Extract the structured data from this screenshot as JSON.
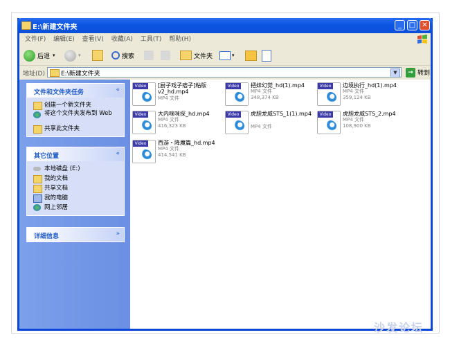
{
  "window": {
    "title": "E:\\新建文件夹"
  },
  "menu": [
    "文件(F)",
    "编辑(E)",
    "查看(V)",
    "收藏(A)",
    "工具(T)",
    "帮助(H)"
  ],
  "toolbar": {
    "back": "后退",
    "search": "搜索",
    "folders": "文件夹"
  },
  "address": {
    "label": "地址(D)",
    "path": "E:\\新建文件夹",
    "go": "转到"
  },
  "sidebar": {
    "tasks": {
      "title": "文件和文件夹任务",
      "items": [
        "创建一个新文件夹",
        "将这个文件夹发布到 Web",
        "共享此文件夹"
      ]
    },
    "places": {
      "title": "其它位置",
      "items": [
        "本地磁盘 (E:)",
        "我的文档",
        "共享文档",
        "我的电脑",
        "网上邻居"
      ]
    },
    "details": {
      "title": "详细信息"
    }
  },
  "files": [
    {
      "name": "[厨子戏子痞子]粘版v2_hd.mp4",
      "type": "MP4 文件",
      "size": "",
      "badge": "Video"
    },
    {
      "name": "把妹幻觉_hd(1).mp4",
      "type": "MP4 文件",
      "size": "348,374 KB",
      "badge": "Video"
    },
    {
      "name": "边境执行_hd(1).mp4",
      "type": "MP4 文件",
      "size": "359,124 KB",
      "badge": "Video"
    },
    {
      "name": "大内咪咪探_hd.mp4",
      "type": "MP4 文件",
      "size": "416,323 KB",
      "badge": "Video"
    },
    {
      "name": "虎胆龙威STS_1(1).mp4",
      "type": "MP4 文件",
      "size": "",
      "badge": "Video"
    },
    {
      "name": "虎胆龙威STS_2.mp4",
      "type": "MP4 文件",
      "size": "108,900 KB",
      "badge": "Video"
    },
    {
      "name": "西游・降魔篇_hd.mp4",
      "type": "MP4 文件",
      "size": "414,541 KB",
      "badge": "Video"
    }
  ],
  "watermark": "沙发论坛"
}
